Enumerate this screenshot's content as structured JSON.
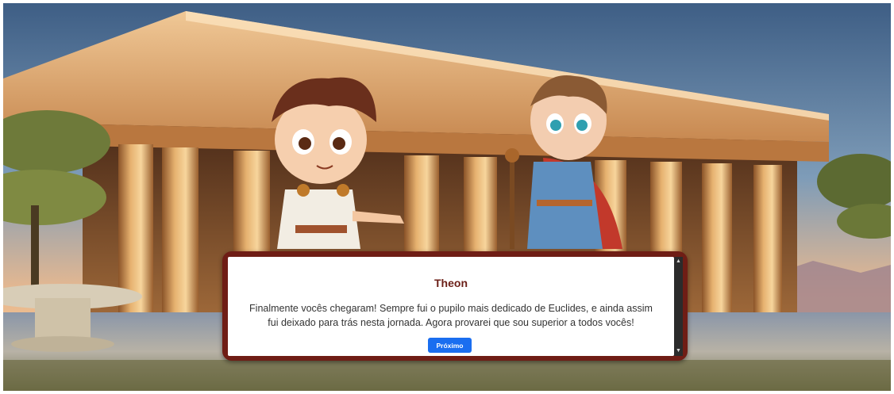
{
  "dialog": {
    "speaker": "Theon",
    "message": "Finalmente vocês chegaram! Sempre fui o pupilo mais dedicado de Euclides, e ainda assim fui deixado para trás nesta jornada. Agora provarei que sou superior a todos vocês!",
    "next_label": "Próximo"
  },
  "scrollbar": {
    "up_icon": "scroll-up-arrow",
    "down_icon": "scroll-down-arrow"
  },
  "colors": {
    "dialog_border": "#6f1d15",
    "speaker_text": "#6b1f17",
    "button": "#1a6ef0"
  }
}
